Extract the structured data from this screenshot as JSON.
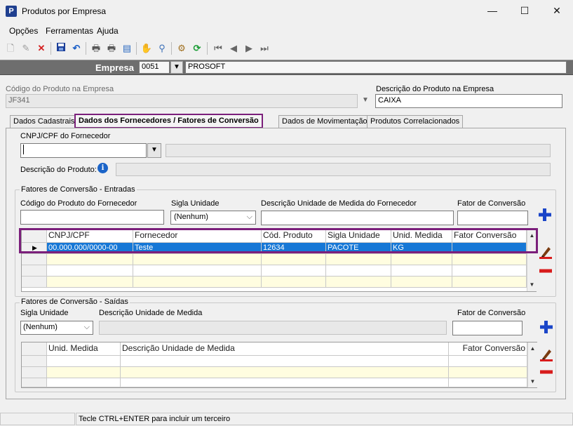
{
  "window": {
    "title": "Produtos por Empresa",
    "app_icon": "P",
    "minimize": "—",
    "maximize": "☐",
    "close": "✕"
  },
  "menu": [
    "Opções",
    "Ferramentas",
    "Ajuda"
  ],
  "toolbar_icons": [
    "new-document-icon",
    "edit-pencil-icon",
    "delete-x-icon",
    "save-disk-icon",
    "undo-icon",
    "print-icon",
    "print-preview-icon",
    "export-icon",
    "hand-icon",
    "search-magnifier-icon",
    "settings-icon",
    "refresh-icon",
    "first-record-icon",
    "previous-record-icon",
    "next-record-icon",
    "last-record-icon"
  ],
  "empresa": {
    "label": "Empresa",
    "code": "0051",
    "name": "PROSOFT"
  },
  "produto": {
    "codigo_label": "Código do Produto na Empresa",
    "codigo_value": "JF341",
    "descricao_label": "Descrição do Produto na Empresa",
    "descricao_value": "CAIXA"
  },
  "tabs": [
    "Dados Cadastrais",
    "Dados dos Fornecedores / Fatores de Conversão",
    "Dados de Movimentação",
    "Produtos Correlacionados"
  ],
  "fornecedor": {
    "cnpj_label": "CNPJ/CPF do Fornecedor",
    "cnpj_value": "",
    "descricao_label": "Descrição do Produto:"
  },
  "entradas": {
    "title": "Fatores de Conversão - Entradas",
    "codigo_label": "Código do Produto do Fornecedor",
    "sigla_label": "Sigla Unidade",
    "sigla_value": "(Nenhum)",
    "descricao_label": "Descrição Unidade de Medida do Fornecedor",
    "fator_label": "Fator de Conversão",
    "columns": [
      "CNPJ/CPF",
      "Fornecedor",
      "Cód. Produto",
      "Sigla Unidade",
      "Unid. Medida",
      "Fator Conversão"
    ],
    "rows": [
      [
        "00.000.000/0000-00",
        "Teste",
        "12634",
        "PACOTE",
        "KG",
        ""
      ]
    ]
  },
  "saidas": {
    "title": "Fatores de Conversão - Saídas",
    "sigla_label": "Sigla Unidade",
    "sigla_value": "(Nenhum)",
    "descricao_label": "Descrição Unidade de Medida",
    "fator_label": "Fator de Conversão",
    "columns": [
      "Unid. Medida",
      "Descrição Unidade de Medida",
      "Fator Conversão"
    ]
  },
  "status": {
    "hint": "Tecle CTRL+ENTER para incluir um terceiro"
  },
  "colors": {
    "highlight_border": "#7b1f7b",
    "selection": "#1677d6",
    "add_blue": "#1a45c8",
    "remove_red": "#d81b1b",
    "empresa_bar": "#6e6e6e"
  }
}
